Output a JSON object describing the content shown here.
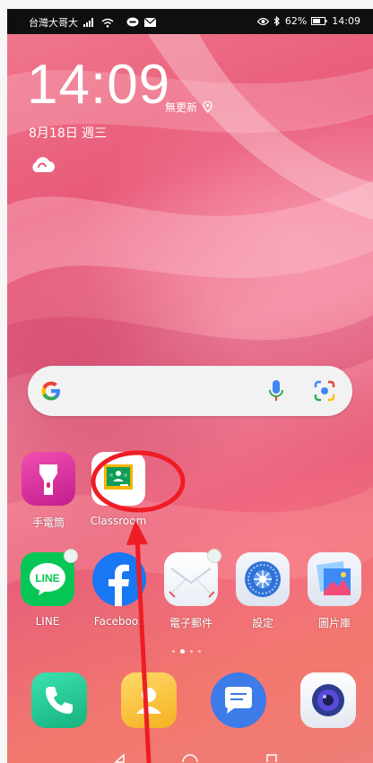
{
  "status_bar": {
    "carrier": "台灣大哥大",
    "battery": "62%",
    "time": "14:09"
  },
  "lockclock": {
    "time": "14:09",
    "weather_status": "無更新",
    "date": "8月18日 週三"
  },
  "search_widget": {
    "icons": [
      "google-logo-icon",
      "mic-icon",
      "google-lens-icon"
    ]
  },
  "apps_row1": [
    {
      "label": "手電筒",
      "icon": "flashlight-icon"
    },
    {
      "label": "Classroom",
      "icon": "google-classroom-icon"
    }
  ],
  "apps_row2": [
    {
      "label": "LINE",
      "icon": "line-icon"
    },
    {
      "label": "Facebook",
      "icon": "facebook-icon"
    },
    {
      "label": "電子郵件",
      "icon": "email-icon"
    },
    {
      "label": "設定",
      "icon": "settings-icon"
    },
    {
      "label": "圖片庫",
      "icon": "gallery-icon"
    }
  ],
  "dock": [
    {
      "icon": "phone-icon"
    },
    {
      "icon": "contacts-icon"
    },
    {
      "icon": "messages-icon"
    },
    {
      "icon": "camera-icon"
    }
  ],
  "page_indicator": {
    "count": 4,
    "active": 1
  },
  "colors": {
    "annotation_red": "#ee1c25",
    "status_bar": "#0f0f0f",
    "search_bar": "#f2f2f2",
    "line_green": "#06c755",
    "facebook_blue": "#1877f2"
  }
}
